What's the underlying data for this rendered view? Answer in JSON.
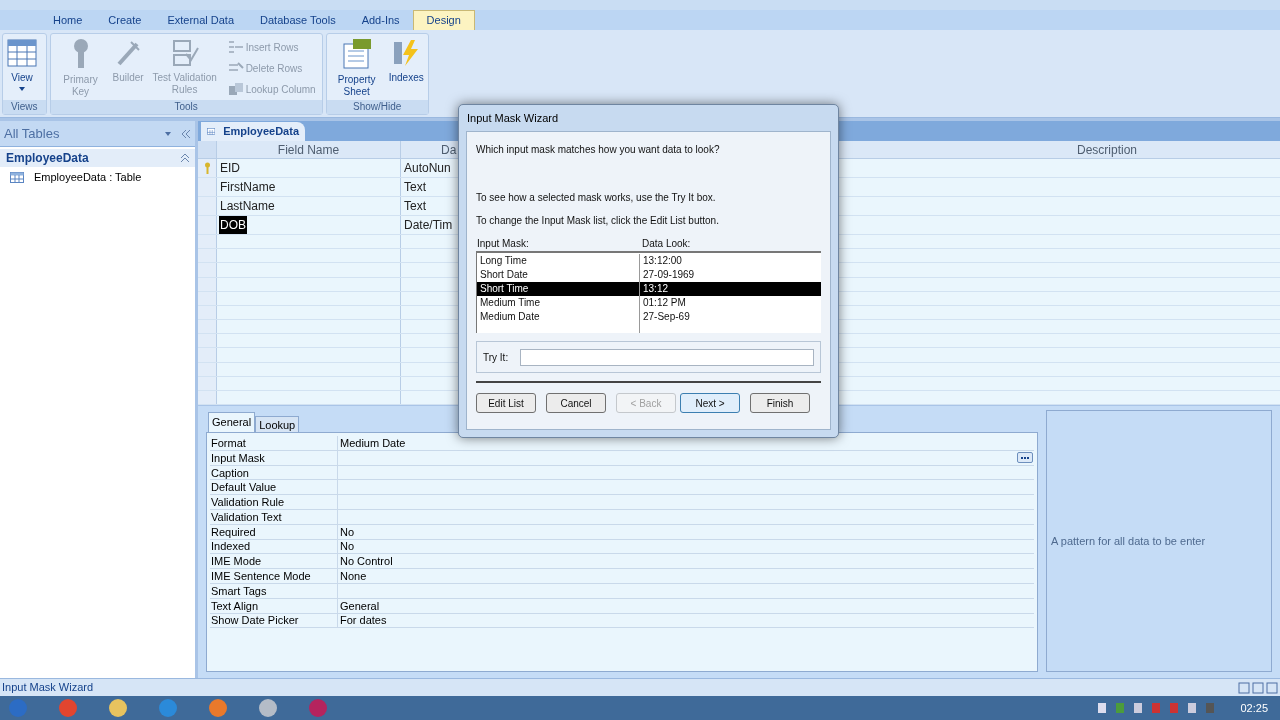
{
  "ribbon": {
    "tabs": [
      {
        "label": "Home",
        "selected": false
      },
      {
        "label": "Create",
        "selected": false
      },
      {
        "label": "External Data",
        "selected": false
      },
      {
        "label": "Database Tools",
        "selected": false
      },
      {
        "label": "Add-Ins",
        "selected": false
      },
      {
        "label": "Design",
        "selected": true
      }
    ],
    "groups": [
      {
        "label": "Views",
        "items": [
          {
            "kind": "menu",
            "label": "View",
            "disabled": false
          }
        ]
      },
      {
        "label": "Tools",
        "items": [
          {
            "kind": "large",
            "label": "Primary Key",
            "disabled": true
          },
          {
            "kind": "large",
            "label": "Builder",
            "disabled": true
          },
          {
            "kind": "large",
            "label": "Test Validation Rules",
            "disabled": true
          },
          {
            "kind": "small",
            "label": "Insert Rows",
            "disabled": true
          },
          {
            "kind": "small",
            "label": "Delete Rows",
            "disabled": true
          },
          {
            "kind": "small",
            "label": "Lookup Column",
            "disabled": true
          }
        ]
      },
      {
        "label": "Show/Hide",
        "items": [
          {
            "kind": "large",
            "label": "Property Sheet",
            "disabled": false
          },
          {
            "kind": "large",
            "label": "Indexes",
            "disabled": false
          }
        ]
      }
    ]
  },
  "navigation": {
    "header": "All Tables",
    "group": "EmployeeData",
    "items": [
      {
        "label": "EmployeeData : Table",
        "selected": false
      }
    ]
  },
  "document_tab": {
    "label": "EmployeeData"
  },
  "table": {
    "columns": [
      "Field Name",
      "Da",
      "Description"
    ],
    "rows": [
      {
        "field_name": "EID",
        "data_type": "AutoNun",
        "primary_key": true,
        "selected": false
      },
      {
        "field_name": "FirstName",
        "data_type": "Text",
        "primary_key": false,
        "selected": false
      },
      {
        "field_name": "LastName",
        "data_type": "Text",
        "primary_key": false,
        "selected": false
      },
      {
        "field_name": "DOB",
        "data_type": "Date/Tim",
        "primary_key": false,
        "selected": true
      }
    ]
  },
  "field_properties": {
    "tabs": [
      {
        "label": "General",
        "selected": true
      },
      {
        "label": "Lookup",
        "selected": false
      }
    ],
    "rows": [
      {
        "name": "Format",
        "value": "Medium Date",
        "builder": false
      },
      {
        "name": "Input Mask",
        "value": "",
        "builder": true
      },
      {
        "name": "Caption",
        "value": "",
        "builder": false
      },
      {
        "name": "Default Value",
        "value": "",
        "builder": false
      },
      {
        "name": "Validation Rule",
        "value": "",
        "builder": false
      },
      {
        "name": "Validation Text",
        "value": "",
        "builder": false
      },
      {
        "name": "Required",
        "value": "No",
        "builder": false
      },
      {
        "name": "Indexed",
        "value": "No",
        "builder": false
      },
      {
        "name": "IME Mode",
        "value": "No Control",
        "builder": false
      },
      {
        "name": "IME Sentence Mode",
        "value": "None",
        "builder": false
      },
      {
        "name": "Smart Tags",
        "value": "",
        "builder": false
      },
      {
        "name": "Text Align",
        "value": "General",
        "builder": false
      },
      {
        "name": "Show Date Picker",
        "value": "For dates",
        "builder": false
      }
    ],
    "help_text": "A pattern for all data to be enter"
  },
  "dialog": {
    "title": "Input Mask Wizard",
    "question": "Which input mask matches how you want data to look?",
    "hint_1": "To see how a selected mask works, use the Try It box.",
    "hint_2": "To change the Input Mask list, click the Edit List button.",
    "list_columns": [
      "Input Mask:",
      "Data Look:"
    ],
    "masks": [
      {
        "mask": "Long Time",
        "data_look": "13:12:00",
        "selected": false
      },
      {
        "mask": "Short Date",
        "data_look": "27-09-1969",
        "selected": false
      },
      {
        "mask": "Short Time",
        "data_look": "13:12",
        "selected": true
      },
      {
        "mask": "Medium Time",
        "data_look": "01:12 PM",
        "selected": false
      },
      {
        "mask": "Medium Date",
        "data_look": "27-Sep-69",
        "selected": false
      }
    ],
    "try_it_label": "Try It:",
    "buttons": [
      {
        "label": "Edit List",
        "disabled": false,
        "default": false
      },
      {
        "label": "Cancel",
        "disabled": false,
        "default": false
      },
      {
        "label": "< Back",
        "disabled": true,
        "default": false
      },
      {
        "label": "Next >",
        "disabled": false,
        "default": true
      },
      {
        "label": "Finish",
        "disabled": false,
        "default": false
      }
    ]
  },
  "status_bar": {
    "text": "Input Mask Wizard"
  },
  "taskbar": {
    "time": "02:25"
  }
}
